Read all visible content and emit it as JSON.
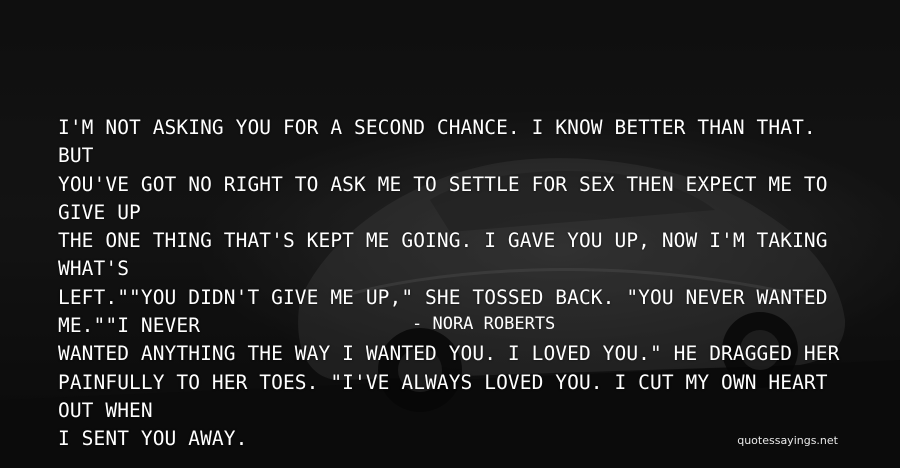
{
  "quote": {
    "lines": [
      "I'M NOT ASKING YOU FOR A SECOND CHANCE. I KNOW BETTER THAN THAT. BUT",
      "YOU'VE GOT NO RIGHT TO ASK ME TO SETTLE FOR SEX THEN EXPECT ME TO GIVE UP",
      "THE ONE THING THAT'S KEPT ME GOING. I GAVE YOU UP, NOW I'M TAKING WHAT'S",
      "LEFT.\"\"YOU DIDN'T GIVE ME UP,\" SHE TOSSED BACK. \"YOU NEVER WANTED ME.\"\"I NEVER",
      "WANTED ANYTHING THE WAY I WANTED YOU. I LOVED YOU.\" HE DRAGGED HER",
      "PAINFULLY TO HER TOES. \"I'VE ALWAYS LOVED YOU. I CUT MY OWN HEART OUT WHEN",
      "I SENT YOU AWAY."
    ]
  },
  "author": "- NORA ROBERTS",
  "watermark": "quotessayings.net",
  "colors": {
    "text": "#ffffff",
    "background": "#141414"
  }
}
